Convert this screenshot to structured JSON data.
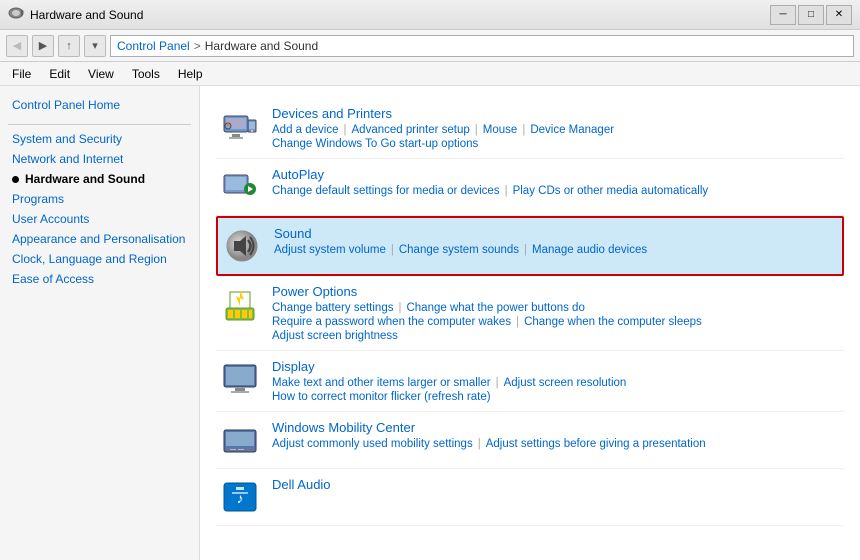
{
  "window": {
    "title": "Hardware and Sound",
    "icon": "speaker-icon"
  },
  "addressBar": {
    "path": [
      "Control Panel",
      "Hardware and Sound"
    ]
  },
  "menuBar": {
    "items": [
      "File",
      "Edit",
      "View",
      "Tools",
      "Help"
    ]
  },
  "sidebar": {
    "home": "Control Panel Home",
    "items": [
      {
        "label": "System and Security",
        "active": false,
        "bullet": false
      },
      {
        "label": "Network and Internet",
        "active": false,
        "bullet": false
      },
      {
        "label": "Hardware and Sound",
        "active": true,
        "bullet": true
      },
      {
        "label": "Programs",
        "active": false,
        "bullet": false
      },
      {
        "label": "User Accounts",
        "active": false,
        "bullet": false
      },
      {
        "label": "Appearance and Personalisation",
        "active": false,
        "bullet": false
      },
      {
        "label": "Clock, Language and Region",
        "active": false,
        "bullet": false
      },
      {
        "label": "Ease of Access",
        "active": false,
        "bullet": false
      }
    ]
  },
  "content": {
    "sections": [
      {
        "id": "devices",
        "title": "Devices and Printers",
        "links": [
          "Add a device",
          "Advanced printer setup",
          "Mouse",
          "Device Manager"
        ],
        "links2": [
          "Change Windows To Go start-up options"
        ],
        "highlighted": false
      },
      {
        "id": "autoplay",
        "title": "AutoPlay",
        "links": [
          "Change default settings for media or devices",
          "Play CDs or other media automatically"
        ],
        "links2": [],
        "highlighted": false
      },
      {
        "id": "sound",
        "title": "Sound",
        "links": [
          "Adjust system volume",
          "Change system sounds",
          "Manage audio devices"
        ],
        "links2": [],
        "highlighted": true
      },
      {
        "id": "power",
        "title": "Power Options",
        "links": [
          "Change battery settings",
          "Change what the power buttons do"
        ],
        "links2": [
          "Require a password when the computer wakes",
          "Change when the computer sleeps"
        ],
        "links3": [
          "Adjust screen brightness"
        ],
        "highlighted": false
      },
      {
        "id": "display",
        "title": "Display",
        "links": [
          "Make text and other items larger or smaller",
          "Adjust screen resolution"
        ],
        "links2": [
          "How to correct monitor flicker (refresh rate)"
        ],
        "highlighted": false
      },
      {
        "id": "mobility",
        "title": "Windows Mobility Center",
        "links": [
          "Adjust commonly used mobility settings",
          "Adjust settings before giving a presentation"
        ],
        "links2": [],
        "highlighted": false
      },
      {
        "id": "dell",
        "title": "Dell Audio",
        "links": [],
        "links2": [],
        "highlighted": false
      }
    ]
  },
  "navButtons": {
    "back": "◀",
    "forward": "▶",
    "up": "↑",
    "recent": "▾"
  }
}
